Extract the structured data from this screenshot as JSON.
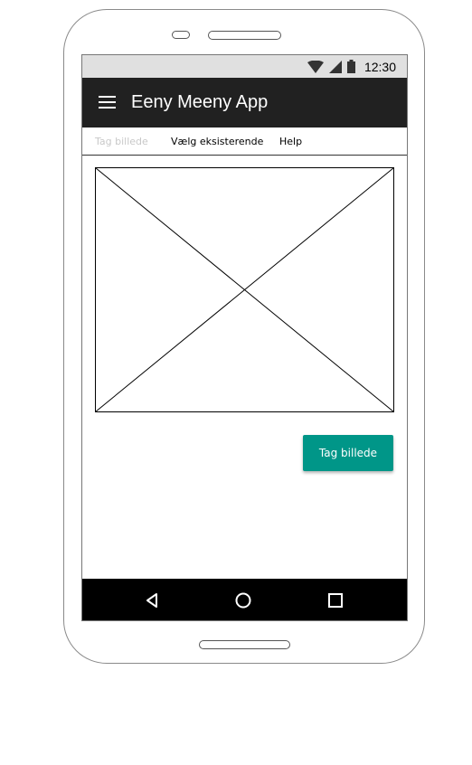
{
  "status_bar": {
    "time": "12:30",
    "icons": [
      "wifi-icon",
      "signal-icon",
      "battery-icon"
    ]
  },
  "app_bar": {
    "menu_icon": "menu-icon",
    "title": "Eeny Meeny App"
  },
  "tabs": [
    {
      "label": "Tag billede",
      "state": "disabled"
    },
    {
      "label": "Vælg eksisterende",
      "state": "enabled"
    },
    {
      "label": "Help",
      "state": "enabled"
    }
  ],
  "main": {
    "image_placeholder": "image-placeholder",
    "action_button_label": "Tag billede"
  },
  "nav_bar": {
    "buttons": [
      "back-icon",
      "home-icon",
      "recents-icon"
    ]
  },
  "colors": {
    "app_bar": "#212121",
    "status_bar": "#e0e0e0",
    "accent": "#009688",
    "nav_bar": "#000000"
  }
}
